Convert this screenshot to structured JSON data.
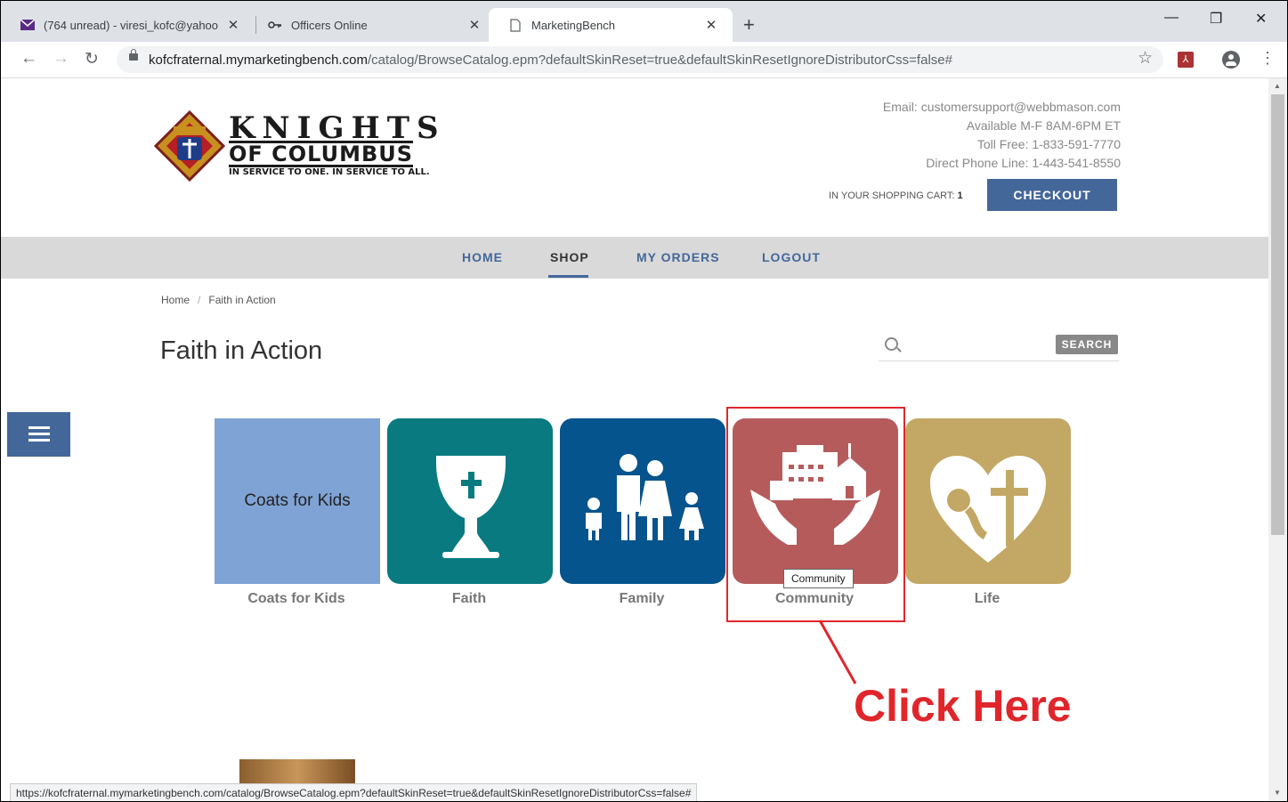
{
  "browser": {
    "tabs": [
      {
        "title": "(764 unread) - viresi_kofc@yahoo",
        "active": false
      },
      {
        "title": "Officers Online",
        "active": false
      },
      {
        "title": "MarketingBench",
        "active": true
      }
    ],
    "url_host": "kofcfraternal.mymarketingbench.com",
    "url_path": "/catalog/BrowseCatalog.epm?defaultSkinReset=true&defaultSkinResetIgnoreDistributorCss=false#",
    "status_url": "https://kofcfraternal.mymarketingbench.com/catalog/BrowseCatalog.epm?defaultSkinReset=true&defaultSkinResetIgnoreDistributorCss=false#"
  },
  "logo": {
    "line1": "KNIGHTS",
    "line2": "OF COLUMBUS",
    "tagline": "IN SERVICE TO ONE. IN SERVICE TO ALL."
  },
  "contact": {
    "email": "Email:  customersupport@webbmason.com",
    "hours": "Available M-F 8AM-6PM ET",
    "toll_free": "Toll Free: 1-833-591-7770",
    "direct": "Direct Phone Line: 1-443-541-8550"
  },
  "cart": {
    "label": "IN YOUR SHOPPING CART:",
    "count": "1"
  },
  "checkout_label": "CHECKOUT",
  "nav": {
    "home": "HOME",
    "shop": "SHOP",
    "my_orders": "MY ORDERS",
    "logout": "LOGOUT",
    "active": "SHOP"
  },
  "breadcrumb": {
    "home": "Home",
    "separator": "/",
    "current": "Faith in Action"
  },
  "page_title": "Faith in Action",
  "search": {
    "placeholder": "",
    "button": "SEARCH"
  },
  "categories": [
    {
      "label": "Coats for Kids",
      "tile_text": "Coats for Kids",
      "color": "#7fa3d5"
    },
    {
      "label": "Faith",
      "color": "#087a80"
    },
    {
      "label": "Family",
      "color": "#05548d"
    },
    {
      "label": "Community",
      "color": "#b65b5c"
    },
    {
      "label": "Life",
      "color": "#c3a764"
    }
  ],
  "tooltip": "Community",
  "annotation": {
    "text": "Click Here",
    "color": "#e0262b"
  }
}
